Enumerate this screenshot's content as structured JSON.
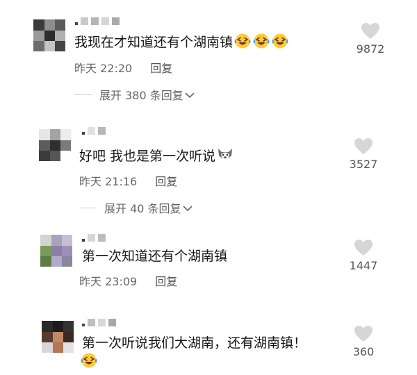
{
  "comments": [
    {
      "text": "我现在才知道还有个湖南镇",
      "time": "昨天 22:20",
      "reply": "回复",
      "expand": "展开 380 条回复",
      "likes": "9872",
      "emoji": [
        "laughing-tears-emoji",
        "laughing-tears-emoji",
        "laughing-tears-emoji"
      ]
    },
    {
      "text": "好吧 我也是第一次听说",
      "time": "昨天 21:16",
      "reply": "回复",
      "expand": "展开 40 条回复",
      "likes": "3527",
      "emoji": [
        "husky-dog-emoji"
      ]
    },
    {
      "text": "第一次知道还有个湖南镇",
      "time": "昨天 23:09",
      "reply": "回复",
      "likes": "1447"
    },
    {
      "text": "第一次听说我们大湖南，还有湖南镇！",
      "likes": "360",
      "emoji": [
        "laughing-tears-emoji"
      ]
    }
  ],
  "icons": {
    "like": "heart-icon",
    "chevron": "chevron-down-icon"
  },
  "colors": {
    "heart": "#d6d6d6",
    "secondary_text": "#666666"
  }
}
